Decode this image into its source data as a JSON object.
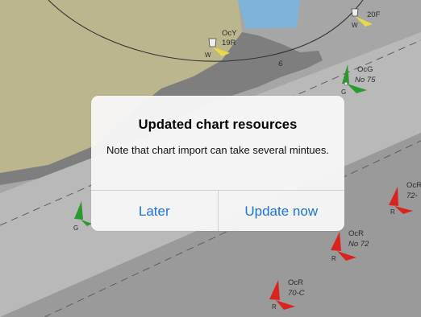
{
  "map": {
    "buoys": [
      {
        "light": "OcY",
        "number": "19R",
        "color_code": "W",
        "icon": "lighthouse-icon"
      },
      {
        "light": "",
        "number": "20F",
        "color_code": "W",
        "icon": "lighthouse-icon"
      },
      {
        "light": "OcG",
        "number": "No 75",
        "color_code": "G",
        "icon": "green-buoy-icon"
      },
      {
        "light": "OcR",
        "number": "72-",
        "color_code": "R",
        "icon": "red-buoy-icon"
      },
      {
        "light": "OcR",
        "number": "No 72",
        "color_code": "R",
        "icon": "red-buoy-icon"
      },
      {
        "light": "OcR",
        "number": "70-C",
        "color_code": "R",
        "icon": "red-buoy-icon"
      },
      {
        "light": "",
        "number": "",
        "color_code": "G",
        "icon": "green-buoy-icon"
      }
    ],
    "colors": {
      "land": "#bcb68f",
      "deep_water": "#9c9c9c",
      "shoal_water": "#b5b5b5",
      "shore": "#7e7e7e",
      "restricted_area": "#7fb3d8",
      "buoy_red": "#d8231f",
      "buoy_green": "#2a9a2e",
      "light_yellow": "#e9d84a"
    }
  },
  "dialog": {
    "title": "Updated chart resources",
    "message": "Note that chart import can take several mintues.",
    "buttons": {
      "later": "Later",
      "update_now": "Update now"
    },
    "accent_color": "#1a73d9"
  }
}
